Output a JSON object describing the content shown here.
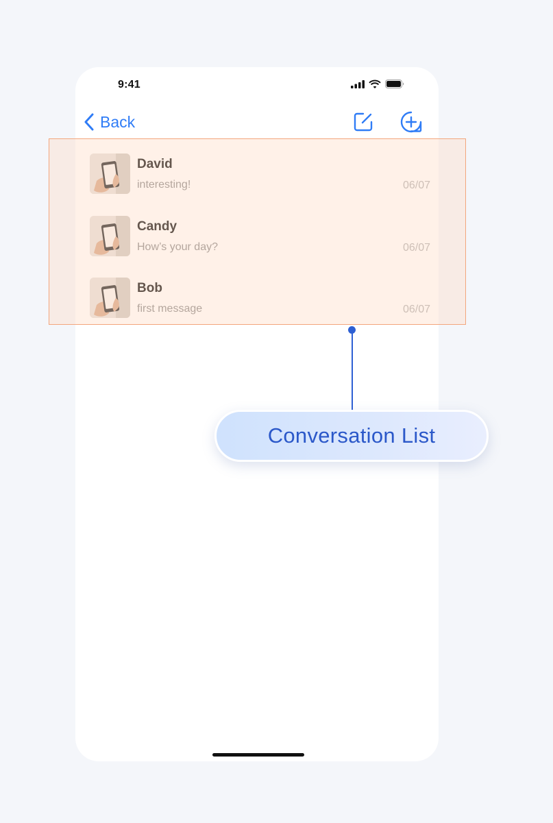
{
  "status_bar": {
    "time": "9:41",
    "icons": [
      "cellular-signal-icon",
      "wifi-icon",
      "battery-icon"
    ]
  },
  "nav": {
    "back_label": "Back",
    "icons": [
      "compose-icon",
      "add-circle-icon"
    ],
    "accent_color": "#2f7cf6"
  },
  "conversations": [
    {
      "name": "David",
      "message": "interesting!",
      "time": "06/07",
      "avatar_icon": "phone-in-hand-photo"
    },
    {
      "name": "Candy",
      "message": "How’s your day?",
      "time": "06/07",
      "avatar_icon": "phone-in-hand-photo"
    },
    {
      "name": "Bob",
      "message": "first message",
      "time": "06/07",
      "avatar_icon": "phone-in-hand-photo"
    }
  ],
  "annotation": {
    "label": "Conversation List",
    "highlight_color": "#f3a57c",
    "connector_color": "#2d5fd3"
  }
}
